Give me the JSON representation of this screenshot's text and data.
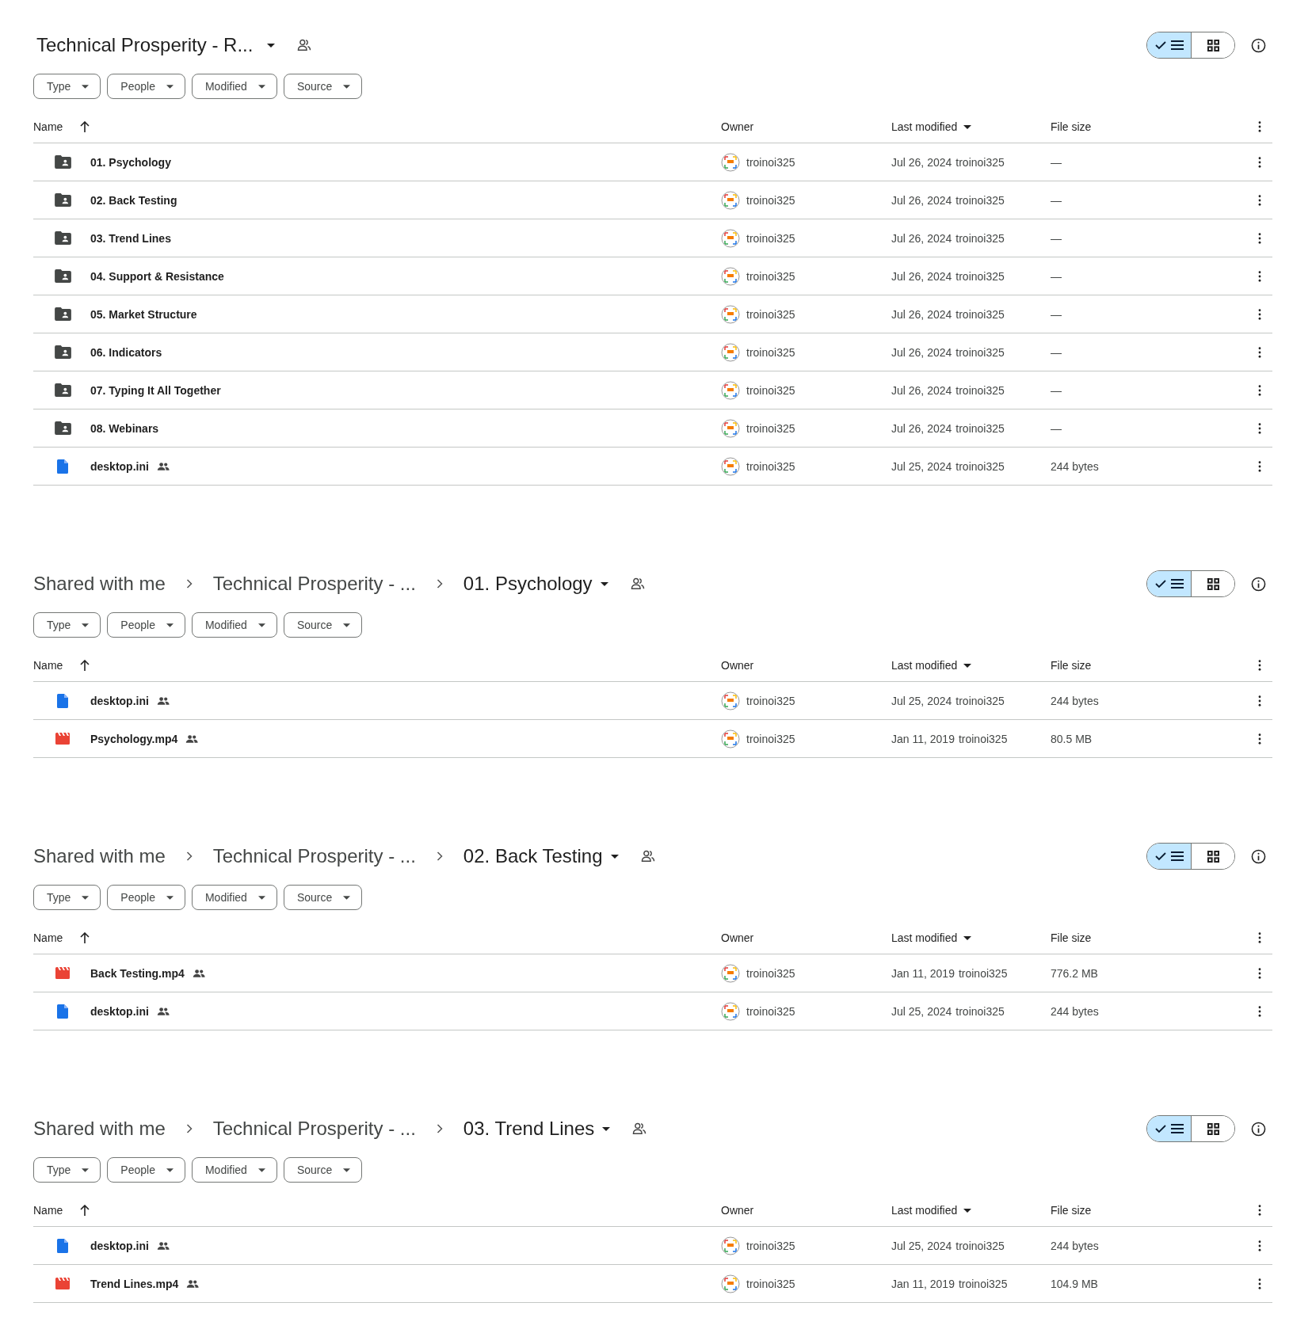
{
  "panels": [
    {
      "title": "Technical Prosperity - R...",
      "view": {
        "list_selected": true,
        "grid_selected": false
      },
      "filters": [
        "Type",
        "People",
        "Modified",
        "Source"
      ],
      "columns": [
        {
          "label": "Name",
          "sort_ascending": true
        },
        {
          "label": "Owner"
        },
        {
          "label": "Last modified",
          "sort_descending": true
        },
        {
          "label": "File size"
        }
      ],
      "rows": [
        {
          "kind": "folder",
          "name": "01. Psychology",
          "shared": false,
          "owner": "troinoi325",
          "modified": "Jul 26, 2024",
          "modified_by": "troinoi325",
          "size": "—"
        },
        {
          "kind": "folder",
          "name": "02. Back Testing",
          "shared": false,
          "owner": "troinoi325",
          "modified": "Jul 26, 2024",
          "modified_by": "troinoi325",
          "size": "—"
        },
        {
          "kind": "folder",
          "name": "03. Trend Lines",
          "shared": false,
          "owner": "troinoi325",
          "modified": "Jul 26, 2024",
          "modified_by": "troinoi325",
          "size": "—"
        },
        {
          "kind": "folder",
          "name": "04. Support & Resistance",
          "shared": false,
          "owner": "troinoi325",
          "modified": "Jul 26, 2024",
          "modified_by": "troinoi325",
          "size": "—"
        },
        {
          "kind": "folder",
          "name": "05. Market Structure",
          "shared": false,
          "owner": "troinoi325",
          "modified": "Jul 26, 2024",
          "modified_by": "troinoi325",
          "size": "—"
        },
        {
          "kind": "folder",
          "name": "06. Indicators",
          "shared": false,
          "owner": "troinoi325",
          "modified": "Jul 26, 2024",
          "modified_by": "troinoi325",
          "size": "—"
        },
        {
          "kind": "folder",
          "name": "07. Typing It All Together",
          "shared": false,
          "owner": "troinoi325",
          "modified": "Jul 26, 2024",
          "modified_by": "troinoi325",
          "size": "—"
        },
        {
          "kind": "folder",
          "name": "08. Webinars",
          "shared": false,
          "owner": "troinoi325",
          "modified": "Jul 26, 2024",
          "modified_by": "troinoi325",
          "size": "—"
        },
        {
          "kind": "document",
          "name": "desktop.ini",
          "shared": true,
          "owner": "troinoi325",
          "modified": "Jul 25, 2024",
          "modified_by": "troinoi325",
          "size": "244 bytes"
        }
      ]
    },
    {
      "breadcrumbs": [
        "Shared with me",
        "Technical Prosperity - ..."
      ],
      "title": "01. Psychology",
      "view": {
        "list_selected": true,
        "grid_selected": false
      },
      "filters": [
        "Type",
        "People",
        "Modified",
        "Source"
      ],
      "columns": [
        {
          "label": "Name",
          "sort_ascending": true
        },
        {
          "label": "Owner"
        },
        {
          "label": "Last modified",
          "sort_descending": true
        },
        {
          "label": "File size"
        }
      ],
      "rows": [
        {
          "kind": "document",
          "name": "desktop.ini",
          "shared": true,
          "owner": "troinoi325",
          "modified": "Jul 25, 2024",
          "modified_by": "troinoi325",
          "size": "244 bytes"
        },
        {
          "kind": "video",
          "name": "Psychology.mp4",
          "shared": true,
          "owner": "troinoi325",
          "modified": "Jan 11, 2019",
          "modified_by": "troinoi325",
          "size": "80.5 MB"
        }
      ]
    },
    {
      "breadcrumbs": [
        "Shared with me",
        "Technical Prosperity - ..."
      ],
      "title": "02. Back Testing",
      "view": {
        "list_selected": true,
        "grid_selected": false
      },
      "filters": [
        "Type",
        "People",
        "Modified",
        "Source"
      ],
      "columns": [
        {
          "label": "Name",
          "sort_ascending": true
        },
        {
          "label": "Owner"
        },
        {
          "label": "Last modified",
          "sort_descending": true
        },
        {
          "label": "File size"
        }
      ],
      "rows": [
        {
          "kind": "video",
          "name": "Back Testing.mp4",
          "shared": true,
          "owner": "troinoi325",
          "modified": "Jan 11, 2019",
          "modified_by": "troinoi325",
          "size": "776.2 MB"
        },
        {
          "kind": "document",
          "name": "desktop.ini",
          "shared": true,
          "owner": "troinoi325",
          "modified": "Jul 25, 2024",
          "modified_by": "troinoi325",
          "size": "244 bytes"
        }
      ]
    },
    {
      "breadcrumbs": [
        "Shared with me",
        "Technical Prosperity - ..."
      ],
      "title": "03. Trend Lines",
      "view": {
        "list_selected": true,
        "grid_selected": false
      },
      "filters": [
        "Type",
        "People",
        "Modified",
        "Source"
      ],
      "columns": [
        {
          "label": "Name",
          "sort_ascending": true
        },
        {
          "label": "Owner"
        },
        {
          "label": "Last modified",
          "sort_descending": true
        },
        {
          "label": "File size"
        }
      ],
      "rows": [
        {
          "kind": "document",
          "name": "desktop.ini",
          "shared": true,
          "owner": "troinoi325",
          "modified": "Jul 25, 2024",
          "modified_by": "troinoi325",
          "size": "244 bytes"
        },
        {
          "kind": "video",
          "name": "Trend Lines.mp4",
          "shared": true,
          "owner": "troinoi325",
          "modified": "Jan 11, 2019",
          "modified_by": "troinoi325",
          "size": "104.9 MB"
        }
      ]
    }
  ]
}
